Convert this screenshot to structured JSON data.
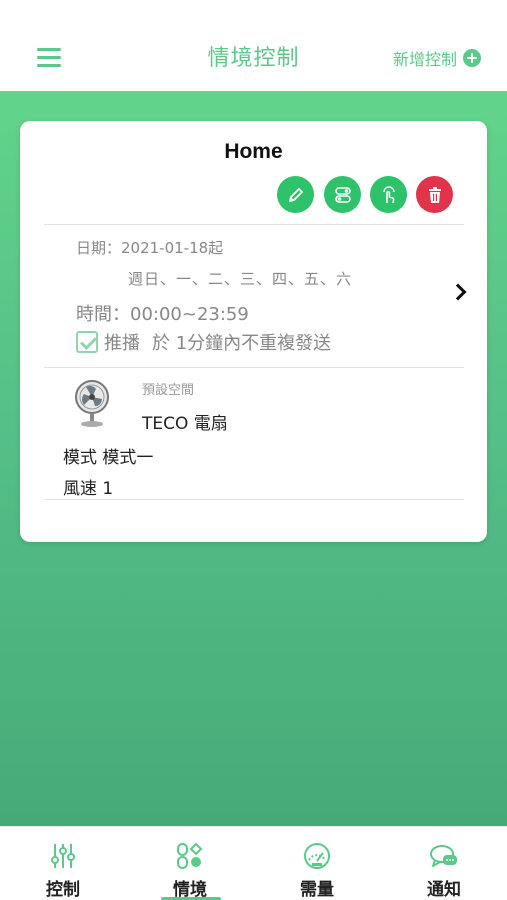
{
  "header": {
    "title": "情境控制",
    "add_label": "新增控制"
  },
  "colors": {
    "accent": "#5cc98a",
    "delete": "#e0344a"
  },
  "scene": {
    "name": "Home",
    "actions": [
      "edit-icon",
      "toggle-icon",
      "touch-icon",
      "delete-icon"
    ],
    "date": "日期：2021-01-18起",
    "days": "週日、一、二、三、四、五、六",
    "time": "時間：00:00~23:59",
    "push_checked": true,
    "push_label": "推播",
    "push_rule": "於 1分鐘內不重複發送",
    "device": {
      "icon": "fan-icon",
      "room": "預設空間",
      "name": "TECO 電扇",
      "mode": "模式 模式一",
      "speed": "風速 1"
    }
  },
  "tabbar": {
    "tabs": [
      {
        "label": "控制",
        "icon": "sliders-icon",
        "active": false
      },
      {
        "label": "情境",
        "icon": "scene-icon",
        "active": true
      },
      {
        "label": "需量",
        "icon": "gauge-icon",
        "active": false
      },
      {
        "label": "通知",
        "icon": "chat-icon",
        "active": false
      }
    ]
  }
}
